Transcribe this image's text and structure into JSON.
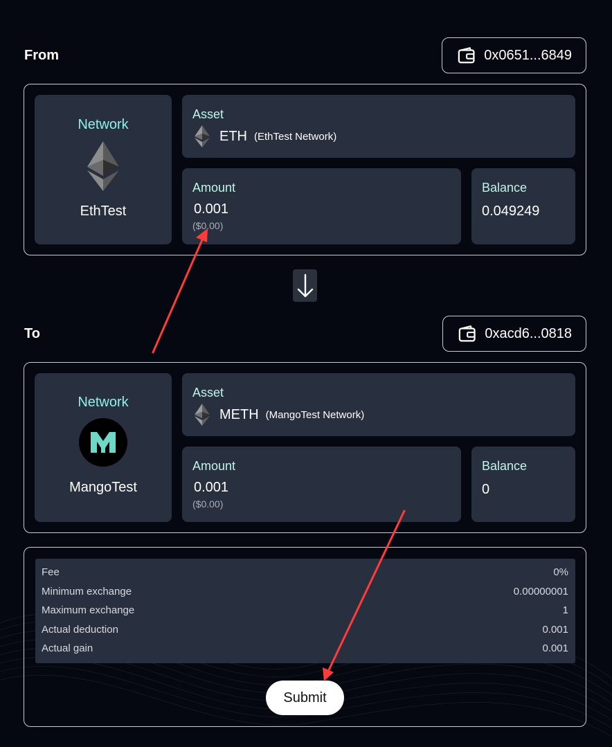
{
  "from": {
    "title": "From",
    "wallet": "0x0651...6849",
    "network_label": "Network",
    "network_name": "EthTest",
    "network_icon": "ethereum-icon",
    "asset_label": "Asset",
    "asset_symbol": "ETH",
    "asset_network": "(EthTest Network)",
    "amount_label": "Amount",
    "amount_value": "0.001",
    "amount_usd": "($0.00)",
    "balance_label": "Balance",
    "balance_value": "0.049249"
  },
  "to": {
    "title": "To",
    "wallet": "0xacd6...0818",
    "network_label": "Network",
    "network_name": "MangoTest",
    "network_icon": "mango-logo-icon",
    "asset_label": "Asset",
    "asset_symbol": "METH",
    "asset_network": "(MangoTest Network)",
    "amount_label": "Amount",
    "amount_value": "0.001",
    "amount_usd": "($0.00)",
    "balance_label": "Balance",
    "balance_value": "0"
  },
  "summary": {
    "rows": [
      {
        "label": "Fee",
        "value": "0%"
      },
      {
        "label": "Minimum exchange",
        "value": "0.00000001"
      },
      {
        "label": "Maximum exchange",
        "value": "1"
      },
      {
        "label": "Actual deduction",
        "value": "0.001"
      },
      {
        "label": "Actual gain",
        "value": "0.001"
      }
    ],
    "submit_label": "Submit"
  },
  "colors": {
    "background": "#050810",
    "card": "#283040",
    "label_teal": "#8ff0e6",
    "annotation_arrow": "#ff3b3b"
  }
}
